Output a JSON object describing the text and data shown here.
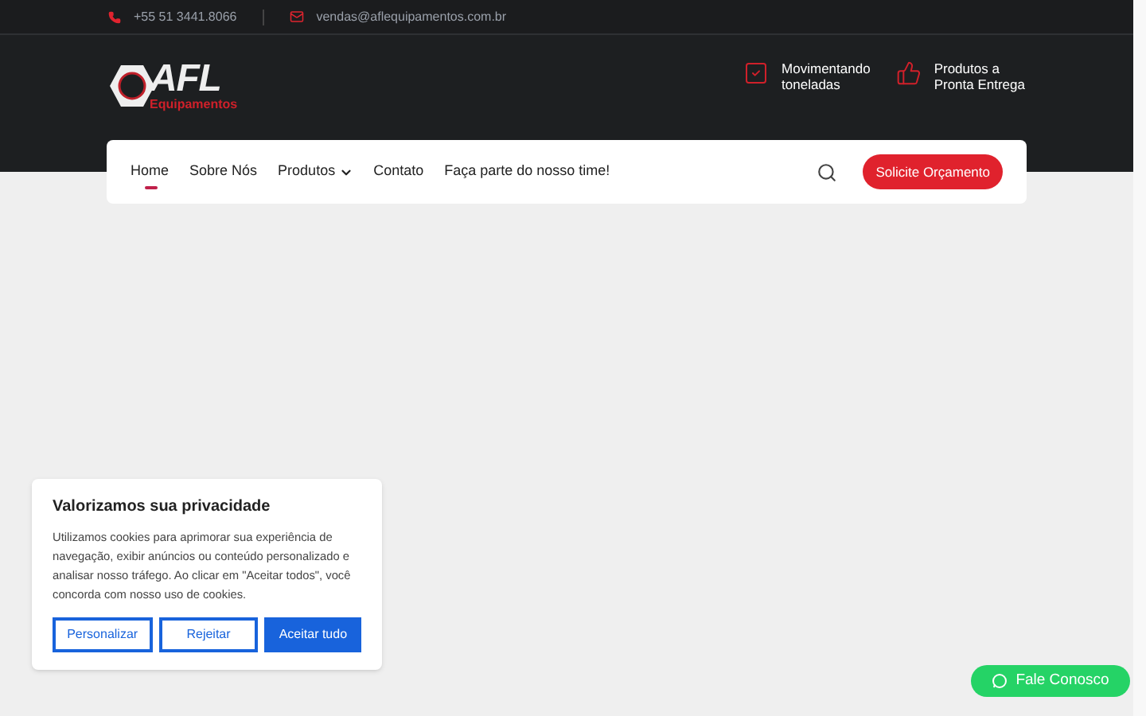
{
  "topbar": {
    "phone": "+55 51 3441.8066",
    "email": "vendas@aflequipamentos.com.br"
  },
  "logo": {
    "text": "AFL",
    "subtext": "Equipamentos"
  },
  "features": [
    {
      "kind": "check",
      "line1": "Movimentando",
      "line2": "toneladas"
    },
    {
      "kind": "thumb",
      "line1": "Produtos a",
      "line2": "Pronta Entrega"
    }
  ],
  "nav": {
    "items": [
      {
        "label": "Home",
        "selected": true,
        "dropdown": false
      },
      {
        "label": "Sobre Nós",
        "selected": false,
        "dropdown": false
      },
      {
        "label": "Produtos",
        "selected": false,
        "dropdown": true
      },
      {
        "label": "Contato",
        "selected": false,
        "dropdown": false
      },
      {
        "label": "Faça parte do nosso time!",
        "selected": false,
        "dropdown": false
      }
    ],
    "cta": "Solicite Orçamento"
  },
  "cookie_banner": {
    "title": "Valorizamos sua privacidade",
    "text": "Utilizamos cookies para aprimorar sua experiência de navegação, exibir anúncios ou conteúdo personalizado e analisar nosso tráfego. Ao clicar em \"Aceitar todos\", você concorda com nosso uso de cookies.",
    "buttons": [
      {
        "label": "Personalizar",
        "kind": "outline"
      },
      {
        "label": "Rejeitar",
        "kind": "outline"
      },
      {
        "label": "Aceitar tudo",
        "kind": "primary"
      }
    ]
  },
  "whatsapp_button": "Fale Conosco"
}
